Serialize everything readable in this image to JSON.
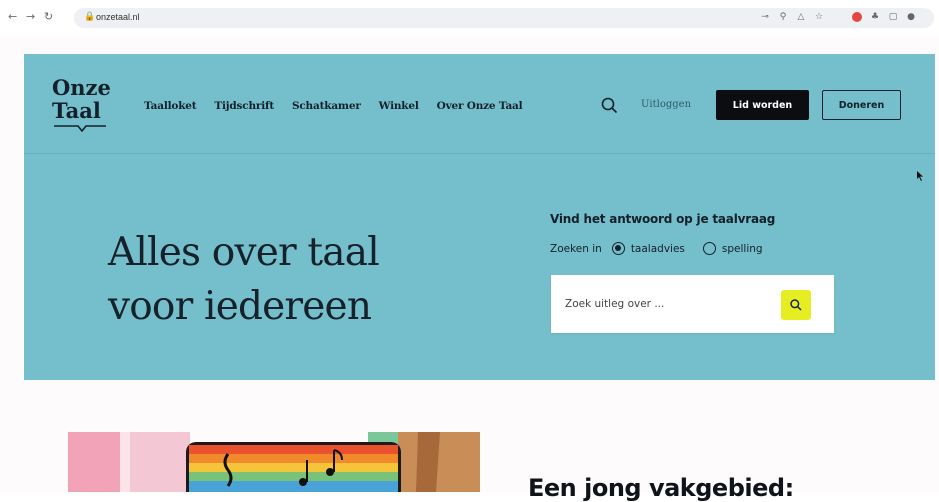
{
  "browser": {
    "url": "onzetaal.nl",
    "back_icon": "arrow-left-icon",
    "forward_icon": "arrow-right-icon",
    "reload_icon": "reload-icon"
  },
  "header": {
    "logo_line1": "Onze",
    "logo_line2": "Taal",
    "nav": [
      "Taalloket",
      "Tijdschrift",
      "Schatkamer",
      "Winkel",
      "Over Onze Taal"
    ],
    "logout_label": "Uitloggen",
    "member_button": "Lid worden",
    "donate_button": "Doneren"
  },
  "hero": {
    "headline_line1": "Alles over taal",
    "headline_line2": "voor iedereen",
    "search_title": "Vind het antwoord op je taalvraag",
    "search_in_label": "Zoeken in",
    "options": [
      {
        "label": "taaladvies",
        "checked": true
      },
      {
        "label": "spelling",
        "checked": false
      }
    ],
    "search_placeholder": "Zoek uitleg over ..."
  },
  "article": {
    "title_partial": "Een jong vakgebied:"
  },
  "colors": {
    "hero_bg": "#74bfcb",
    "dark": "#14202a",
    "accent_yellow": "#e6ee22"
  }
}
